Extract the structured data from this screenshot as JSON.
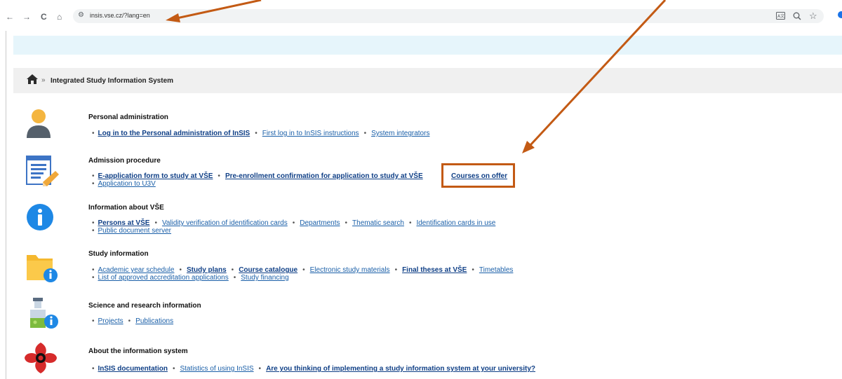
{
  "browser": {
    "url": "insis.vse.cz/?lang=en",
    "back_icon": "←",
    "forward_icon": "→",
    "reload_icon": "C",
    "home_icon": "⌂",
    "right_icons": [
      "translate-icon",
      "zoom-icon",
      "star-icon"
    ]
  },
  "breadcrumb": {
    "separator": "»",
    "title": "Integrated Study Information System"
  },
  "sections": {
    "personal": {
      "title": "Personal administration",
      "links": [
        {
          "label": "Log in to the Personal administration of InSIS",
          "bold": true
        },
        {
          "label": "First log in to InSIS instructions",
          "bold": false
        },
        {
          "label": "System integrators",
          "bold": false
        }
      ]
    },
    "admission": {
      "title": "Admission procedure",
      "links": [
        {
          "label": "E-application form to study at VŠE",
          "bold": true
        },
        {
          "label": "Pre-enrollment confirmation for application to study at VŠE",
          "bold": true
        }
      ],
      "highlight": "Courses on offer",
      "links2": [
        {
          "label": "Application to U3V",
          "bold": false
        }
      ]
    },
    "info": {
      "title": "Information about VŠE",
      "links": [
        {
          "label": "Persons at VŠE",
          "bold": true
        },
        {
          "label": "Validity verification of identification cards",
          "bold": false
        },
        {
          "label": "Departments",
          "bold": false
        },
        {
          "label": "Thematic search",
          "bold": false
        },
        {
          "label": "Identification cards in use",
          "bold": false
        }
      ],
      "links2": [
        {
          "label": "Public document server",
          "bold": false
        }
      ]
    },
    "study": {
      "title": "Study information",
      "links": [
        {
          "label": "Academic year schedule",
          "bold": false
        },
        {
          "label": "Study plans",
          "bold": true
        },
        {
          "label": "Course catalogue",
          "bold": true
        },
        {
          "label": "Electronic study materials",
          "bold": false
        },
        {
          "label": "Final theses at VŠE",
          "bold": true
        },
        {
          "label": "Timetables",
          "bold": false
        }
      ],
      "links2": [
        {
          "label": "List of approved accreditation applications",
          "bold": false
        },
        {
          "label": "Study financing",
          "bold": false
        }
      ]
    },
    "science": {
      "title": "Science and research information",
      "links": [
        {
          "label": "Projects",
          "bold": false
        },
        {
          "label": "Publications",
          "bold": false
        }
      ]
    },
    "about": {
      "title": "About the information system",
      "links": [
        {
          "label": "InSIS documentation",
          "bold": true
        },
        {
          "label": "Statistics of using InSIS",
          "bold": false
        },
        {
          "label": "Are you thinking of implementing a study information system at your university?",
          "bold": true
        }
      ]
    }
  },
  "colors": {
    "annotation": "#c35a14",
    "link": "#1a5fa8",
    "banner": "#e6f5fb"
  }
}
